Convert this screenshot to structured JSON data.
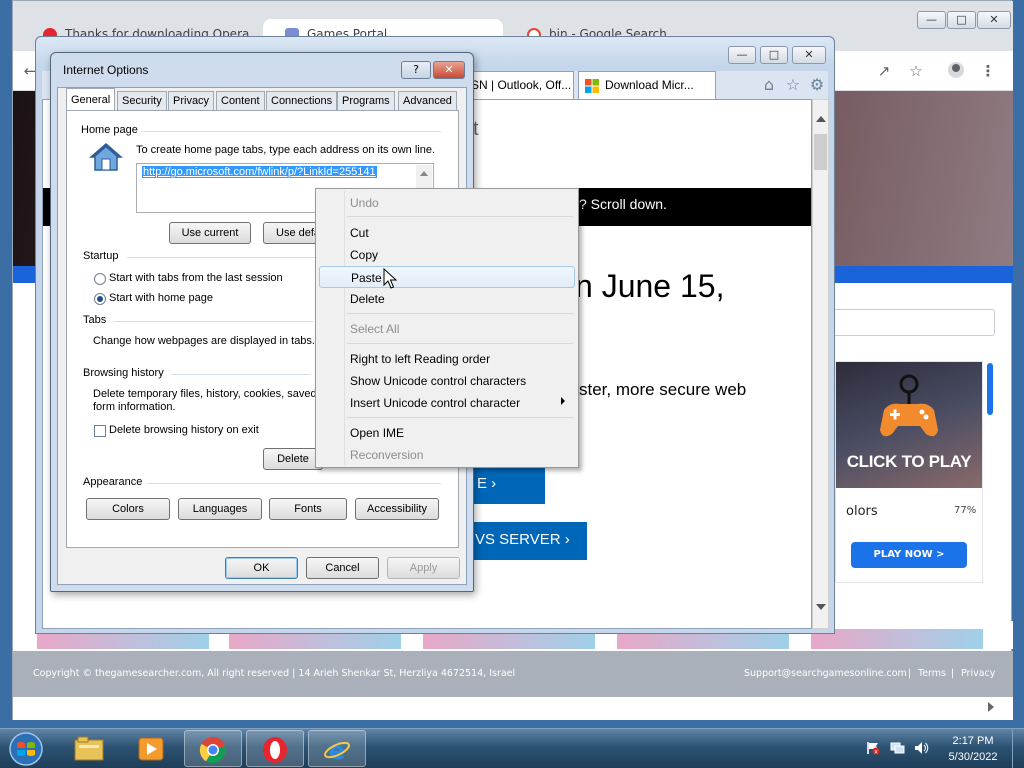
{
  "chrome": {
    "tabs": [
      {
        "title": "Thanks for downloading Opera",
        "color": "#e8242e"
      },
      {
        "title": "Games Portal",
        "color": "#7b8cd6"
      },
      {
        "title": "bin - Google Search",
        "color": "#e84335"
      }
    ],
    "footer": {
      "copyright": "Copyright © thegamesearcher.com, All right reserved | 14 Arieh Shenkar St, Herzliya 4672514, Israel",
      "support": "Support@searchgamesonline.com",
      "terms": "Terms",
      "privacy": "Privacy"
    },
    "game_card": {
      "banner": "CLICK TO PLAY",
      "name": "olors",
      "percent": "77%",
      "play": "PLAY NOW >"
    }
  },
  "ie": {
    "tabs": [
      {
        "title": "SN | Outlook, Off..."
      },
      {
        "title": "Download Micr...",
        "close": "✕"
      }
    ],
    "page": {
      "heading_fragment": "t",
      "blackbar": "? Scroll down.",
      "big": "n June 15,",
      "sub": "ster, more secure web",
      "btn1": "E  ›",
      "btn2": "VS SERVER  ›"
    }
  },
  "dialog": {
    "title": "Internet Options",
    "help_btn": "?",
    "close_btn": "✕",
    "tabs": [
      "General",
      "Security",
      "Privacy",
      "Content",
      "Connections",
      "Programs",
      "Advanced"
    ],
    "home_page": {
      "group": "Home page",
      "instruction": "To create home page tabs, type each address on its own line.",
      "url": "http://go.microsoft.com/fwlink/p/?LinkId=255141",
      "use_current": "Use current",
      "use_default": "Use defa"
    },
    "startup": {
      "group": "Startup",
      "opt1": "Start with tabs from the last session",
      "opt2": "Start with home page"
    },
    "tabs_group": {
      "group": "Tabs",
      "desc": "Change how webpages are displayed in tabs."
    },
    "browsing_history": {
      "group": "Browsing history",
      "desc1": "Delete temporary files, history, cookies, saved",
      "desc2": "form information.",
      "checkbox": "Delete browsing history on exit",
      "delete_btn": "Delete"
    },
    "appearance": {
      "group": "Appearance",
      "colors": "Colors",
      "languages": "Languages",
      "fonts": "Fonts",
      "accessibility": "Accessibility"
    },
    "ok": "OK",
    "cancel": "Cancel",
    "apply": "Apply"
  },
  "context_menu": {
    "undo": "Undo",
    "cut": "Cut",
    "copy": "Copy",
    "paste": "Paste",
    "delete": "Delete",
    "select_all": "Select All",
    "rtl": "Right to left Reading order",
    "show_unicode": "Show Unicode control characters",
    "insert_unicode": "Insert Unicode control character",
    "open_ime": "Open IME",
    "reconversion": "Reconversion"
  },
  "taskbar": {
    "time": "2:17 PM",
    "date": "5/30/2022"
  }
}
